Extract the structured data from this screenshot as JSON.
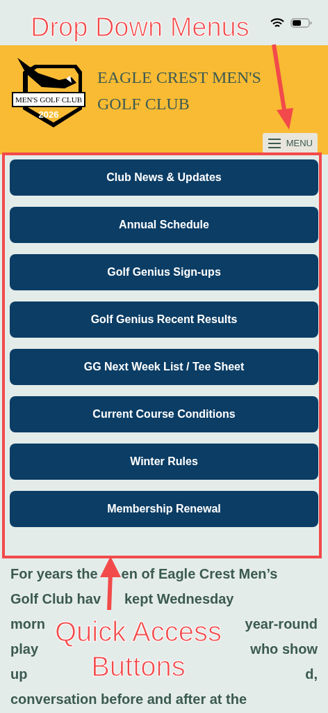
{
  "header": {
    "title": "EAGLE CREST MEN'S GOLF CLUB",
    "logo": {
      "banner": "MEN'S GOLF CLUB",
      "year": "2026"
    },
    "menu_button": "MENU"
  },
  "quick_access_buttons": [
    {
      "label": "Club News & Updates"
    },
    {
      "label": "Annual Schedule"
    },
    {
      "label": "Golf Genius Sign-ups"
    },
    {
      "label": "Golf Genius Recent Results"
    },
    {
      "label": "GG Next Week List / Tee Sheet"
    },
    {
      "label": "Current Course Conditions"
    },
    {
      "label": "Winter Rules"
    },
    {
      "label": "Membership Renewal"
    }
  ],
  "intro_lines": [
    [
      "For years the",
      "en of Eagle Crest Men’s"
    ],
    [
      "Golf Club hav",
      "kept Wednesday"
    ],
    [
      "morn",
      "year-round"
    ],
    [
      "play",
      "who show"
    ],
    [
      "up",
      "d,"
    ],
    [
      "conversation before and after at the"
    ]
  ],
  "annotations": [
    {
      "text": "Drop Down Menus"
    },
    {
      "text": "Quick Access Buttons"
    }
  ]
}
